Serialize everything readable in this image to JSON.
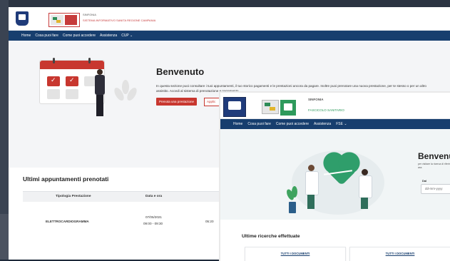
{
  "back_window": {
    "brand": {
      "line1": "SINFONIA",
      "line2": "SISTEMA INFORMATIVO SANITA REGIONE CAMPANIA"
    },
    "nav": [
      "Home",
      "Cosa puoi fare",
      "Come puoi accedere",
      "Assistenza",
      "CUP ⌄"
    ],
    "welcome": {
      "title": "Benvenuto",
      "text": "In questa sezione puoi consultare i tuoi appuntamenti, il tuo storico pagamenti e le prestazioni ancora da pagare. Inoltre puoi prenotare una nuova prestazione, per te stesso o per un altro assistito. Accedi al sistema di prenotazione e pagamento.",
      "primary_button": "Prenota una prestazione",
      "secondary_button": "Applic"
    },
    "appointments": {
      "title": "Ultimi appuntamenti prenotati",
      "columns": [
        "Tipologia Prestazione",
        "Data e ora"
      ],
      "rows": [
        {
          "type": "ELETTROCARDIOGRAMMA",
          "date": "07/05/2021",
          "time": "09:00 - 09:30",
          "extra": "05:20"
        }
      ]
    }
  },
  "front_window": {
    "brand": {
      "line1": "SINFONIA",
      "line2": "FASCICOLO SANITARIO"
    },
    "nav": [
      "Home",
      "Cosa puoi fare",
      "Come puoi accedere",
      "Assistenza",
      "FSE ⌄"
    ],
    "welcome": {
      "title": "Benvenu",
      "text": "per visitare la ricerca di riferimento sui ass",
      "date_label": "Dal",
      "date_placeholder": "dd-mm-yyyy"
    },
    "recent_searches": {
      "title": "Ultime ricerche effettuate",
      "cards": [
        "TUTTI I DOCUMENTI",
        "TUTTI I DOCUMENTI"
      ]
    }
  },
  "colors": {
    "nav": "#173e6e",
    "accent_red": "#c8372f",
    "accent_green": "#2f9e6b"
  }
}
